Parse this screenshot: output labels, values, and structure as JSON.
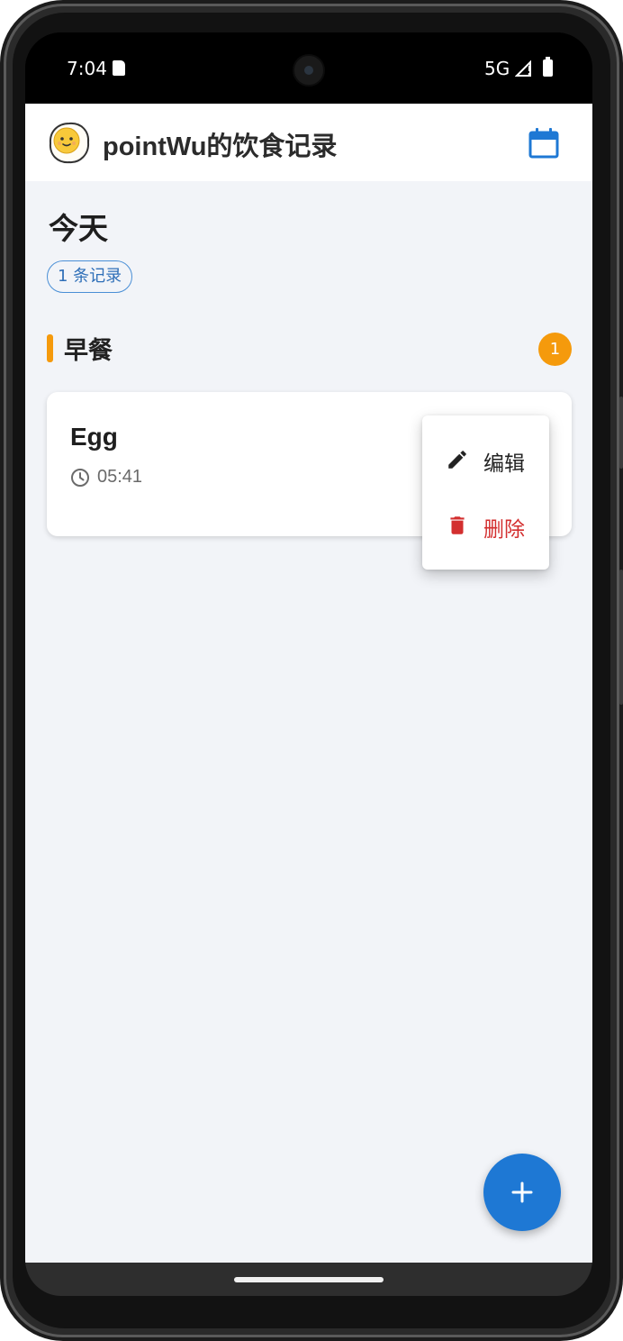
{
  "status_bar": {
    "time": "7:04",
    "network": "5G"
  },
  "app_bar": {
    "title": "pointWu的饮食记录"
  },
  "day": {
    "title": "今天",
    "count_chip": "1 条记录"
  },
  "section": {
    "title": "早餐",
    "count": "1",
    "accent_color": "#f59a0c"
  },
  "entries": [
    {
      "name": "Egg",
      "time": "05:41"
    }
  ],
  "menu": {
    "edit_label": "编辑",
    "delete_label": "删除"
  },
  "colors": {
    "primary": "#1e78d4",
    "danger": "#d32f2f",
    "background": "#f2f4f8"
  },
  "icons": {
    "app_logo": "fried-egg-icon",
    "calendar": "calendar-icon",
    "clock": "clock-icon",
    "edit": "pencil-icon",
    "delete": "trash-icon",
    "fab": "plus-icon"
  }
}
